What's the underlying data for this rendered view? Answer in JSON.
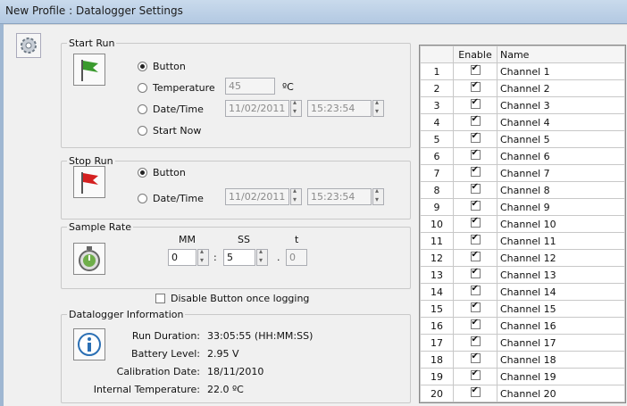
{
  "window": {
    "title": "New Profile : Datalogger Settings"
  },
  "start_run": {
    "legend": "Start Run",
    "options": [
      "Button",
      "Temperature",
      "Date/Time",
      "Start Now"
    ],
    "selected": "Button",
    "temperature_value": "45",
    "temperature_unit": "ºC",
    "date": "11/02/2011",
    "time": "15:23:54"
  },
  "stop_run": {
    "legend": "Stop Run",
    "options": [
      "Button",
      "Date/Time"
    ],
    "selected": "Button",
    "date": "11/02/2011",
    "time": "15:23:54"
  },
  "sample_rate": {
    "legend": "Sample Rate",
    "mm_label": "MM",
    "ss_label": "SS",
    "t_label": "t",
    "mm": "0",
    "ss": "5",
    "t": "0",
    "sep_colon": ":",
    "sep_dot": "."
  },
  "disable_button": {
    "label": "Disable Button once logging",
    "checked": false
  },
  "info": {
    "legend": "Datalogger Information",
    "rows": [
      {
        "label": "Run Duration:",
        "value": "33:05:55 (HH:MM:SS)"
      },
      {
        "label": "Battery Level:",
        "value": "2.95 V"
      },
      {
        "label": "Calibration Date:",
        "value": "18/11/2010"
      },
      {
        "label": "Internal Temperature:",
        "value": "22.0 ºC"
      }
    ]
  },
  "channels": {
    "headers": [
      "",
      "Enable",
      "Name"
    ],
    "rows": [
      {
        "num": "1",
        "name": "Channel 1"
      },
      {
        "num": "2",
        "name": "Channel 2"
      },
      {
        "num": "3",
        "name": "Channel 3"
      },
      {
        "num": "4",
        "name": "Channel 4"
      },
      {
        "num": "5",
        "name": "Channel 5"
      },
      {
        "num": "6",
        "name": "Channel 6"
      },
      {
        "num": "7",
        "name": "Channel 7"
      },
      {
        "num": "8",
        "name": "Channel 8"
      },
      {
        "num": "9",
        "name": "Channel 9"
      },
      {
        "num": "10",
        "name": "Channel 10"
      },
      {
        "num": "11",
        "name": "Channel 11"
      },
      {
        "num": "12",
        "name": "Channel 12"
      },
      {
        "num": "13",
        "name": "Channel 13"
      },
      {
        "num": "14",
        "name": "Channel 14"
      },
      {
        "num": "15",
        "name": "Channel 15"
      },
      {
        "num": "16",
        "name": "Channel 16"
      },
      {
        "num": "17",
        "name": "Channel 17"
      },
      {
        "num": "18",
        "name": "Channel 18"
      },
      {
        "num": "19",
        "name": "Channel 19"
      },
      {
        "num": "20",
        "name": "Channel 20"
      }
    ]
  },
  "colors": {
    "start_flag": "#3a9a2e",
    "stop_flag": "#d42020",
    "info_icon": "#2a6fb4"
  }
}
